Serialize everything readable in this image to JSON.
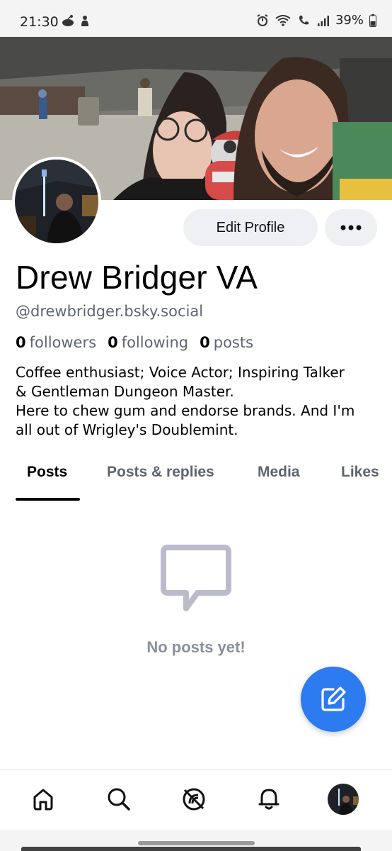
{
  "status_bar": {
    "time": "21:30",
    "battery": "39%",
    "left_icons": [
      "reddit-icon",
      "notification-icon"
    ],
    "right_icons": [
      "alarm-icon",
      "wifi-calling-icon",
      "volte-call-icon",
      "signal-icon",
      "battery-icon"
    ]
  },
  "profile": {
    "banner": "banner-photo",
    "avatar": "avatar-photo",
    "edit_label": "Edit Profile",
    "more_label": "•••",
    "display_name": "Drew Bridger VA",
    "handle": "@drewbridger.bsky.social",
    "stats": [
      {
        "count": "0",
        "label": "followers"
      },
      {
        "count": "0",
        "label": "following"
      },
      {
        "count": "0",
        "label": "posts"
      }
    ],
    "bio_lines": [
      "Coffee enthusiast; Voice Actor; Inspiring Talker",
      "& Gentleman Dungeon Master.",
      "Here to chew gum and endorse brands. And I'm",
      "all out of Wrigley's Doublemint."
    ]
  },
  "tabs": [
    {
      "label": "Posts",
      "active": true
    },
    {
      "label": "Posts & replies",
      "active": false
    },
    {
      "label": "Media",
      "active": false
    },
    {
      "label": "Likes",
      "active": false
    }
  ],
  "empty_state": {
    "icon": "speech-bubble-icon",
    "text": "No posts yet!"
  },
  "fab": {
    "icon": "compose-icon"
  },
  "bottom_nav": [
    {
      "name": "home",
      "icon": "home-icon"
    },
    {
      "name": "search",
      "icon": "search-icon"
    },
    {
      "name": "feeds",
      "icon": "feeds-icon"
    },
    {
      "name": "notifications",
      "icon": "bell-icon"
    },
    {
      "name": "profile",
      "icon": "avatar"
    }
  ],
  "colors": {
    "accent": "#2d7bf0",
    "button_bg": "#eef0f4",
    "muted_text": "#5e6470",
    "empty_icon": "#b9bccb"
  }
}
